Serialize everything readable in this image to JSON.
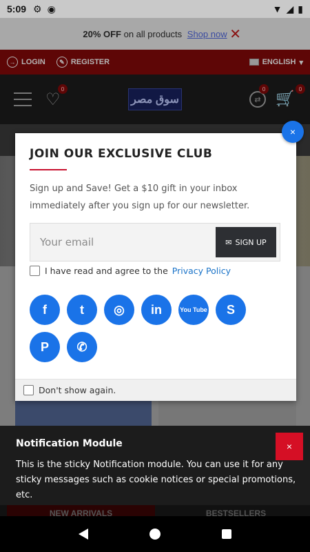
{
  "status_bar": {
    "time": "5:09"
  },
  "promo": {
    "bold": "20% OFF",
    "text": " on all products ",
    "link": "Shop now",
    "close": "✕"
  },
  "topnav": {
    "login": "LOGIN",
    "register": "REGISTER",
    "language": "ENGLISH"
  },
  "header": {
    "wishlist_count": "0",
    "compare_count": "0",
    "cart_count": "0",
    "logo_text": "سوق مصر"
  },
  "modal": {
    "title": "JOIN OUR EXCLUSIVE CLUB",
    "text": "Sign up and Save! Get a $10 gift in your inbox immediately after you sign up for our newsletter.",
    "email_placeholder": "Your email",
    "signup_label": "SIGN UP",
    "agree_label": "I have read and agree to the",
    "privacy_label": "Privacy Policy",
    "dont_show": "Don't show again.",
    "close": "×"
  },
  "socials": [
    {
      "name": "facebook-icon",
      "glyph": "f"
    },
    {
      "name": "twitter-icon",
      "glyph": "t"
    },
    {
      "name": "instagram-icon",
      "glyph": "◎"
    },
    {
      "name": "linkedin-icon",
      "glyph": "in"
    },
    {
      "name": "youtube-icon",
      "glyph": "You Tube"
    },
    {
      "name": "skype-icon",
      "glyph": "S"
    },
    {
      "name": "pinterest-icon",
      "glyph": "P"
    },
    {
      "name": "whatsapp-icon",
      "glyph": "✆"
    }
  ],
  "notification": {
    "title": "Notification Module",
    "text": "This is the sticky Notification module. You can use it for any sticky messages such as cookie notices or special promotions, etc.",
    "close": "×"
  },
  "tabs": {
    "new_arrivals": "NEW ARRIVALS",
    "bestsellers": "BESTSELLERS"
  },
  "colors": {
    "accent": "#1a73e8",
    "brand_red": "#c8102e",
    "close_red": "#d50f25"
  }
}
